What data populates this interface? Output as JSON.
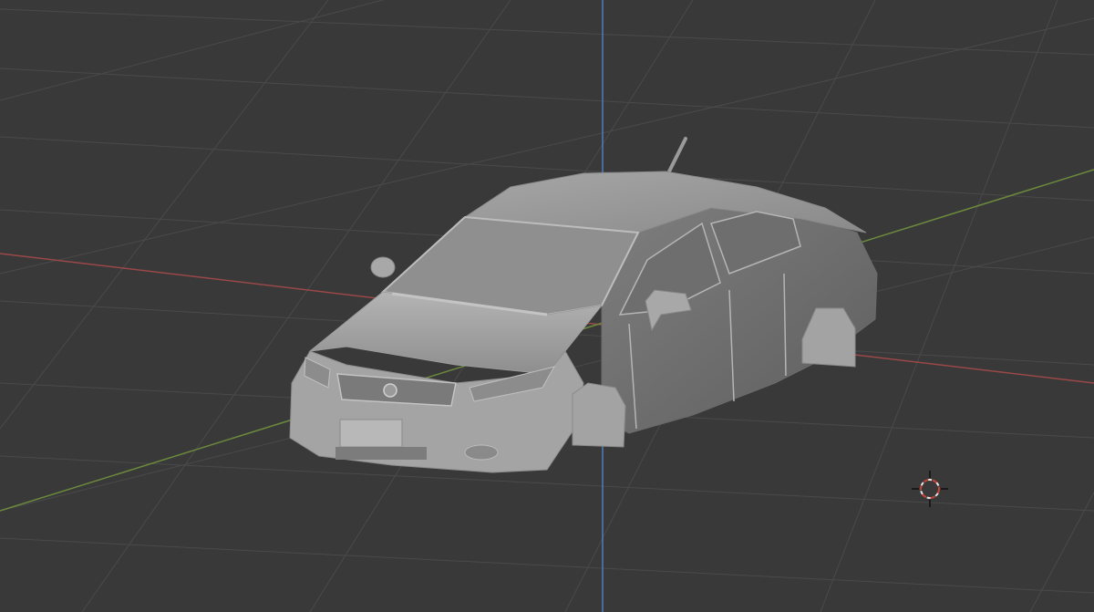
{
  "viewport": {
    "mode": "3d-viewport",
    "background_color": "#393939",
    "grid_color": "#4a4a4a",
    "x_axis_color": "#9a4848",
    "y_axis_color": "#6c8a3c",
    "z_axis_color": "#4f7fb8",
    "model_color": "#a9a9a9",
    "cursor_color": "#c8443a",
    "object": "sedan-car-body-model",
    "icons": [
      "3d-cursor-icon"
    ]
  }
}
